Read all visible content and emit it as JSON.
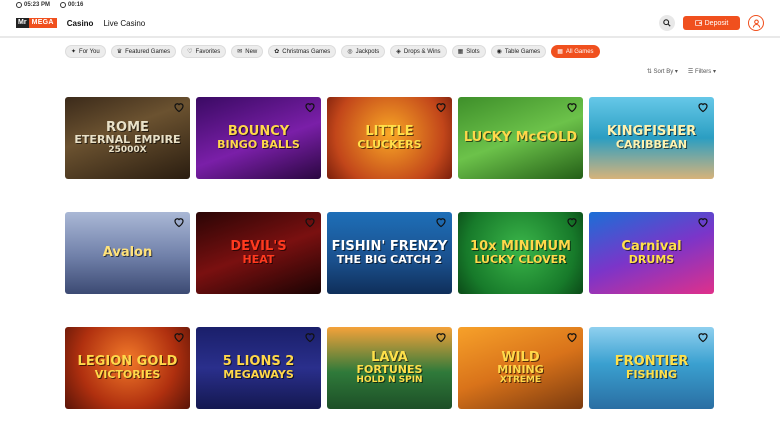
{
  "status": {
    "time1": "05:23 PM",
    "time2": "00:16"
  },
  "brand": {
    "mr": "Mr",
    "mega": "MEGA"
  },
  "nav": {
    "casino": "Casino",
    "live": "Live Casino"
  },
  "header": {
    "deposit": "Deposit"
  },
  "filters": [
    {
      "label": "For You",
      "icon": "sparkle-icon"
    },
    {
      "label": "Featured Games",
      "icon": "featured-icon"
    },
    {
      "label": "Favorites",
      "icon": "heart-icon"
    },
    {
      "label": "New",
      "icon": "new-icon"
    },
    {
      "label": "Christmas Games",
      "icon": "christmas-icon"
    },
    {
      "label": "Jackpots",
      "icon": "jackpot-icon"
    },
    {
      "label": "Drops & Wins",
      "icon": "drops-icon"
    },
    {
      "label": "Slots",
      "icon": "slots-icon"
    },
    {
      "label": "Table Games",
      "icon": "table-games-icon"
    },
    {
      "label": "All Games",
      "icon": "all-games-icon",
      "active": true
    }
  ],
  "sort": {
    "sort": "Sort By",
    "filters": "Filters"
  },
  "colors": {
    "accent": "#f0501e"
  },
  "games": [
    {
      "t1": "ROME",
      "t2": "ETERNAL EMPIRE",
      "t3": "25000X",
      "bg": "linear-gradient(160deg,#3b2a1a,#6b5230 40%,#2a1d10)",
      "c": "#e9e1c8"
    },
    {
      "t1": "BOUNCY",
      "t2": "BINGO BALLS",
      "t3": "",
      "bg": "linear-gradient(160deg,#3a0a63,#7a1fa8 55%,#2a0740)",
      "c": "#ffd84a"
    },
    {
      "t1": "LITTLE",
      "t2": "CLUCKERS",
      "t3": "",
      "bg": "radial-gradient(circle at 50% 45%,#f9a826,#c2461a 70%,#7a1f0c)",
      "c": "#ffe04a"
    },
    {
      "t1": "LUCKY McGOLD",
      "t2": "",
      "t3": "",
      "bg": "linear-gradient(160deg,#3e8f2a,#6cc24a 50%,#245f17)",
      "c": "#ffd84a"
    },
    {
      "t1": "KINGFISHER",
      "t2": "CARIBBEAN",
      "t3": "",
      "bg": "linear-gradient(180deg,#66c8e8,#2b9ec2 50%,#d7b37a)",
      "c": "#fff3b0"
    },
    {
      "t1": "Avalon",
      "t2": "",
      "t3": "",
      "bg": "linear-gradient(180deg,#aab8d6,#6f7fa8 55%,#3c4a73)",
      "c": "#ffe27a"
    },
    {
      "t1": "DEVIL'S",
      "t2": "HEAT",
      "t3": "",
      "bg": "linear-gradient(160deg,#2a0505,#7a1010 50%,#1a0303)",
      "c": "#ff3a1f"
    },
    {
      "t1": "FISHIN' FRENZY",
      "t2": "THE BIG CATCH 2",
      "t3": "",
      "bg": "linear-gradient(180deg,#1e6fb8,#1a4f8c 60%,#0f2f5a)",
      "c": "#ffffff"
    },
    {
      "t1": "10x MINIMUM",
      "t2": "LUCKY CLOVER",
      "t3": "",
      "bg": "radial-gradient(circle at 50% 45%,#3bb64a,#177a2a 70%,#0b4a18)",
      "c": "#ffd84a"
    },
    {
      "t1": "Carnival",
      "t2": "DRUMS",
      "t3": "",
      "bg": "linear-gradient(160deg,#1b6fd6,#7b35c9 50%,#e0308a)",
      "c": "#ffe04a"
    },
    {
      "t1": "LEGION GOLD",
      "t2": "VICTORIES",
      "t3": "",
      "bg": "radial-gradient(circle at 50% 40%,#f27a2a,#b0300f 60%,#5a1408)",
      "c": "#ffd84a"
    },
    {
      "t1": "5 LIONS 2",
      "t2": "MEGAWAYS",
      "t3": "",
      "bg": "linear-gradient(180deg,#1a1f6a,#2a2f8c 50%,#141850)",
      "c": "#ffd84a"
    },
    {
      "t1": "LAVA",
      "t2": "FORTUNES",
      "t3": "HOLD N SPIN",
      "bg": "linear-gradient(180deg,#f5a23a,#2f7a3a 55%,#1d4f27)",
      "c": "#ffe04a"
    },
    {
      "t1": "WILD",
      "t2": "MINING",
      "t3": "XTREME",
      "bg": "linear-gradient(160deg,#f7a12a,#d9731a 50%,#7a3a0f)",
      "c": "#ffd84a"
    },
    {
      "t1": "FRONTIER",
      "t2": "FISHING",
      "t3": "",
      "bg": "linear-gradient(180deg,#8fd0ef,#3aa0d0 45%,#2a6ea3)",
      "c": "#ffe04a"
    }
  ]
}
